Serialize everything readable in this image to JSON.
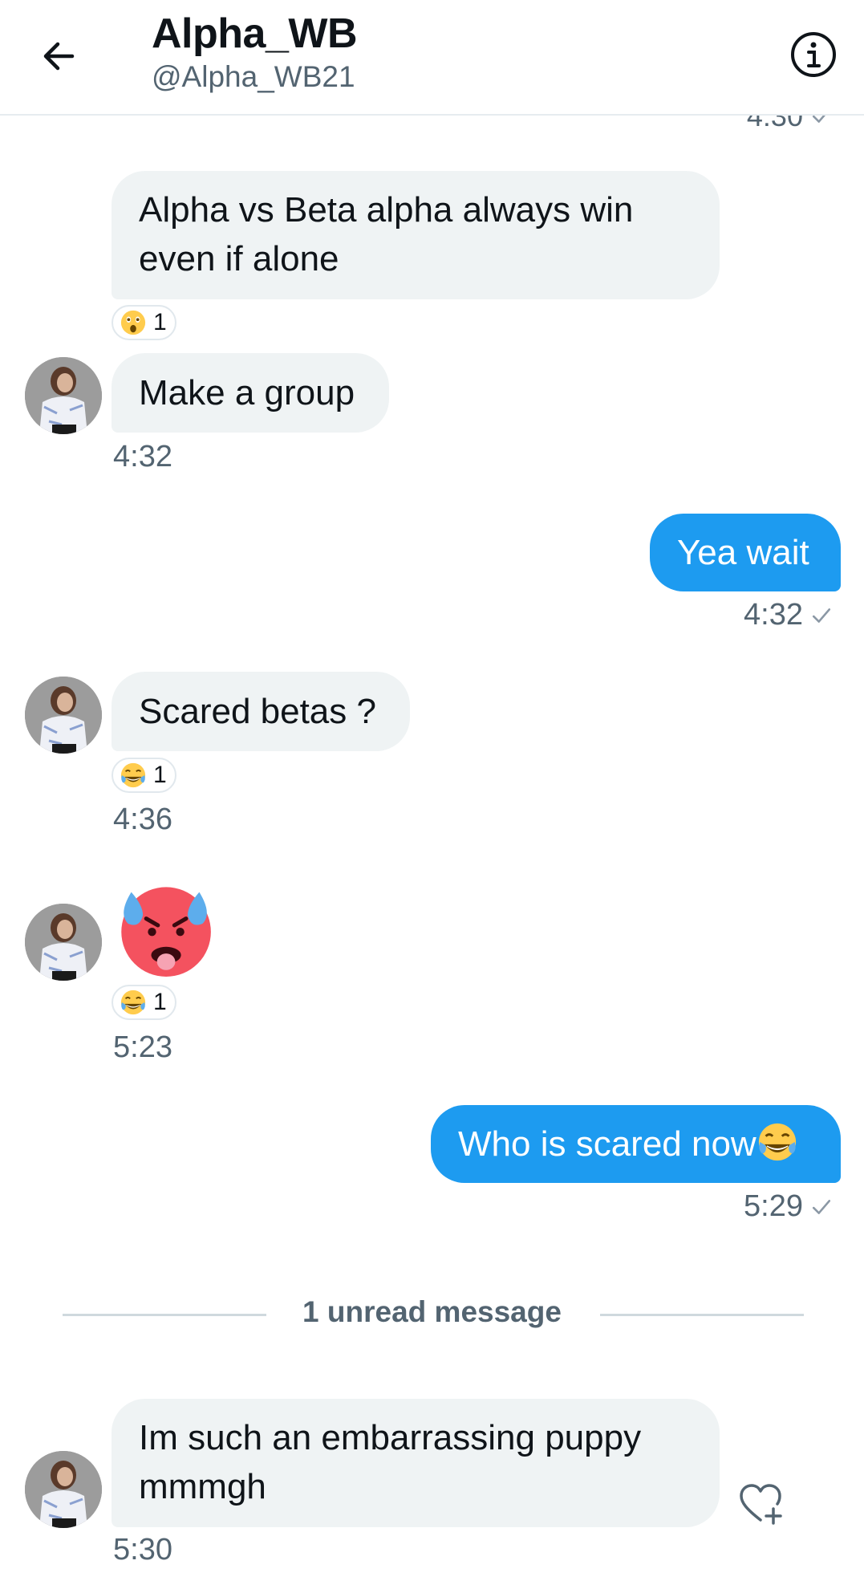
{
  "header": {
    "title": "Alpha_WB",
    "handle": "@Alpha_WB21"
  },
  "clipped_timestamp": "4:30",
  "messages": [
    {
      "direction": "in",
      "text": "Alpha vs Beta alpha always win even if alone",
      "reaction": {
        "emoji": "astonished-face",
        "count": "1"
      }
    },
    {
      "direction": "in",
      "text": "Make a group",
      "time": "4:32"
    },
    {
      "direction": "out",
      "text": "Yea wait",
      "time": "4:32"
    },
    {
      "direction": "in",
      "text": "Scared betas ?",
      "reaction": {
        "emoji": "tears-of-joy-face",
        "count": "1"
      },
      "time": "4:36"
    },
    {
      "direction": "in",
      "emoji": "hot-face",
      "reaction": {
        "emoji": "tears-of-joy-face",
        "count": "1"
      },
      "time": "5:23"
    },
    {
      "direction": "out",
      "text": "Who is scared now",
      "trailing_emoji": "tears-of-joy-face",
      "time": "5:29"
    },
    {
      "direction": "in",
      "text": "Im such an embarrassing puppy mmmgh",
      "time": "5:30"
    }
  ],
  "divider": {
    "text": "1 unread message"
  },
  "colors": {
    "outgoing_bubble": "#1d9bf0",
    "incoming_bubble": "#eff3f4",
    "secondary_text": "#536471"
  }
}
